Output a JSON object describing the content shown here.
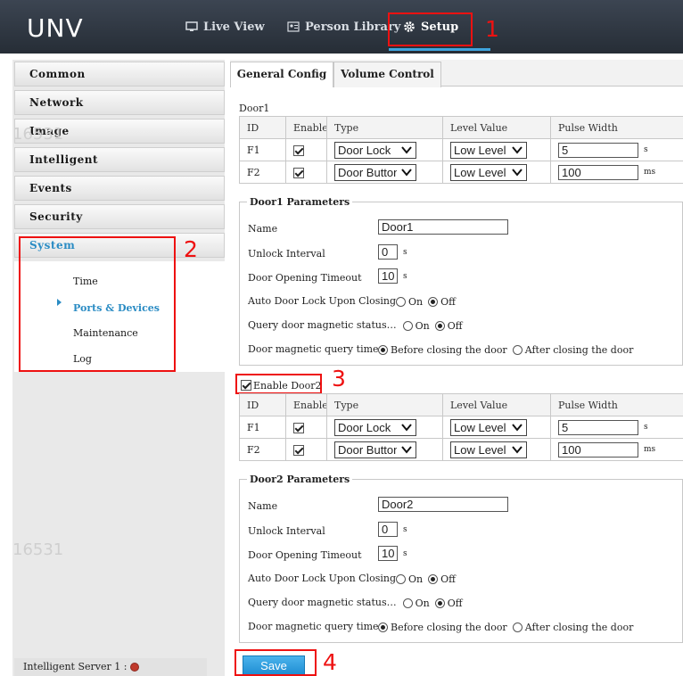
{
  "header": {
    "logo": "UNV",
    "nav": {
      "live_view": "Live View",
      "person_library": "Person Library",
      "setup": "Setup"
    }
  },
  "annotations": {
    "n1": "1",
    "n2": "2",
    "n3": "3",
    "n4": "4"
  },
  "watermark": "16531",
  "sidebar": {
    "items": [
      "Common",
      "Network",
      "Image",
      "Intelligent",
      "Events",
      "Security",
      "System"
    ],
    "system_sub": [
      "Time",
      "Ports & Devices",
      "Maintenance",
      "Log"
    ],
    "server_label": "Intelligent Server 1 :"
  },
  "tabs": {
    "general": "General Config",
    "volume": "Volume Control"
  },
  "columns": [
    "ID",
    "Enable",
    "Type",
    "Level Value",
    "Pulse Width"
  ],
  "door1": {
    "title": "Door1",
    "rows": [
      {
        "id": "F1",
        "type": "Door Lock",
        "level": "Low Level",
        "pulse": "5",
        "unit": "s"
      },
      {
        "id": "F2",
        "type": "Door Button",
        "level": "Low Level",
        "pulse": "100",
        "unit": "ms"
      }
    ],
    "params": {
      "legend": "Door1 Parameters",
      "name_label": "Name",
      "name_value": "Door1",
      "unlock_label": "Unlock Interval",
      "unlock_value": "0",
      "unlock_unit": "s",
      "timeout_label": "Door Opening Timeout",
      "timeout_value": "10",
      "timeout_unit": "s",
      "autolock_label": "Auto Door Lock Upon Closing",
      "query_label": "Query door magnetic status…",
      "on": "On",
      "off": "Off",
      "magtime_label": "Door magnetic query time",
      "before": "Before closing the door",
      "after": "After closing the door"
    }
  },
  "door2": {
    "enable_label": "Enable Door2",
    "rows": [
      {
        "id": "F1",
        "type": "Door Lock",
        "level": "Low Level",
        "pulse": "5",
        "unit": "s"
      },
      {
        "id": "F2",
        "type": "Door Button",
        "level": "Low Level",
        "pulse": "100",
        "unit": "ms"
      }
    ],
    "params": {
      "legend": "Door2 Parameters",
      "name_label": "Name",
      "name_value": "Door2",
      "unlock_label": "Unlock Interval",
      "unlock_value": "0",
      "unlock_unit": "s",
      "timeout_label": "Door Opening Timeout",
      "timeout_value": "10",
      "timeout_unit": "s",
      "autolock_label": "Auto Door Lock Upon Closing",
      "query_label": "Query door magnetic status…",
      "on": "On",
      "off": "Off",
      "magtime_label": "Door magnetic query time",
      "before": "Before closing the door",
      "after": "After closing the door"
    }
  },
  "save_label": "Save",
  "colors": {
    "accent": "#2b8cc4",
    "annotation_red": "#e11111",
    "header_bg": "#2f3742"
  }
}
